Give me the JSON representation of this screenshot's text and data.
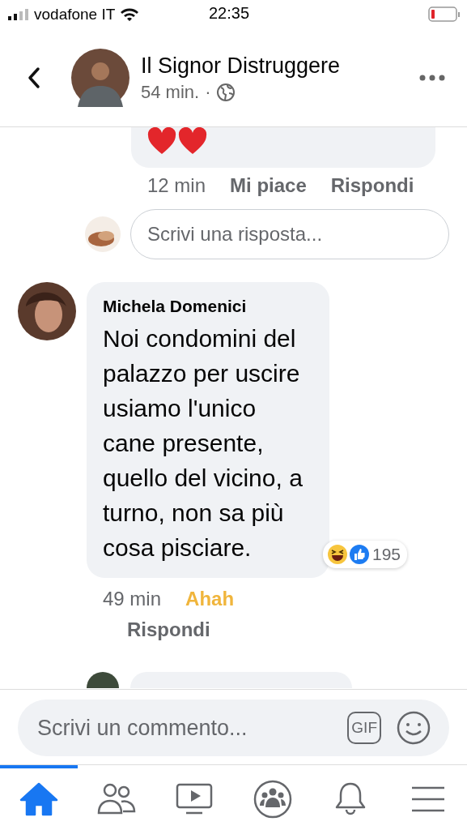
{
  "status_bar": {
    "carrier": "vodafone IT",
    "time": "22:35"
  },
  "header": {
    "title": "Il Signor Distruggere",
    "time": "54 min.",
    "separator": "·"
  },
  "prev_reply": {
    "time": "12 min",
    "actions": [
      "Mi piace",
      "Rispondi"
    ]
  },
  "reply_field": {
    "placeholder": "Scrivi una risposta..."
  },
  "comment": {
    "author": "Michela Domenici",
    "text": "Noi condomini del palazzo per uscire usiamo l'unico cane presente, quello del vicino, a turno, non sa più cosa pisciare.",
    "reaction_count": "195",
    "time": "49 min",
    "reaction": "Ahah",
    "reply": "Rispondi"
  },
  "comment_field": {
    "placeholder": "Scrivi un commento...",
    "gif": "GIF"
  },
  "tabs": [
    {
      "kind": "home",
      "selected": true
    },
    {
      "kind": "friends",
      "selected": false
    },
    {
      "kind": "video",
      "selected": false
    },
    {
      "kind": "groups",
      "selected": false
    },
    {
      "kind": "notifications",
      "selected": false
    },
    {
      "kind": "menu",
      "selected": false
    }
  ]
}
